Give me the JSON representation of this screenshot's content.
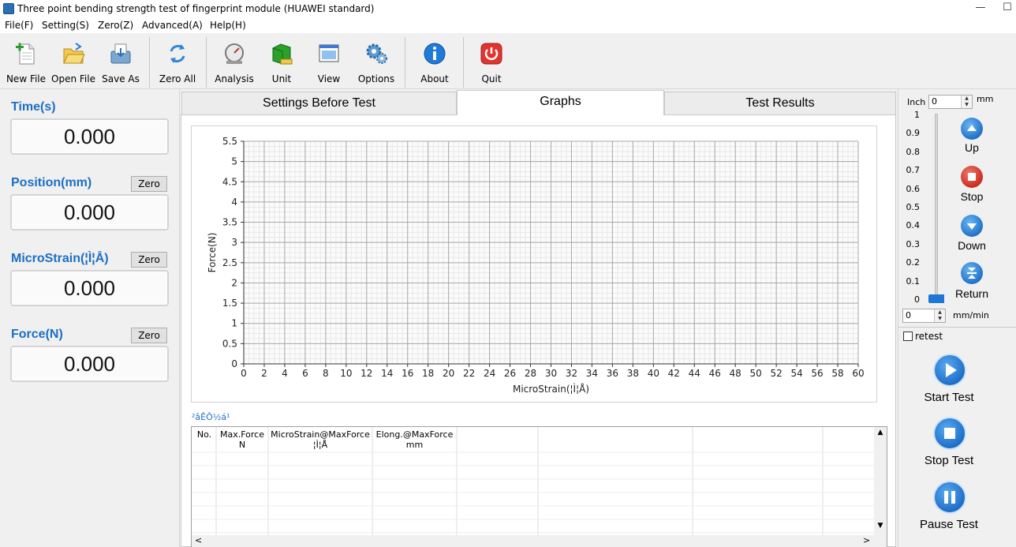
{
  "window": {
    "title": "Three point bending strength test of fingerprint module (HUAWEI standard)",
    "minimize_glyph": "—",
    "maximize_glyph": "☐"
  },
  "menu": [
    "File(F)",
    "Setting(S)",
    "Zero(Z)",
    "Advanced(A)",
    "Help(H)"
  ],
  "toolbar": {
    "new_file": "New File",
    "open_file": "Open File",
    "save_as": "Save As",
    "zero_all": "Zero All",
    "analysis": "Analysis",
    "unit": "Unit",
    "view": "View",
    "options": "Options",
    "about": "About",
    "quit": "Quit"
  },
  "measurements": {
    "time_label": "Time(s)",
    "time_value": "0.000",
    "position_label": "Position(mm)",
    "position_value": "0.000",
    "microstrain_label": "MicroStrain(¦Ì¦Å)",
    "microstrain_value": "0.000",
    "force_label": "Force(N)",
    "force_value": "0.000",
    "zero_label": "Zero"
  },
  "tabs": [
    "Settings Before Test",
    "Graphs",
    "Test Results"
  ],
  "results_table": {
    "label": "²âÊÔ½á¹",
    "headers": [
      {
        "line1": "No.",
        "line2": ""
      },
      {
        "line1": "Max.Force",
        "line2": "N"
      },
      {
        "line1": "MicroStrain@MaxForce",
        "line2": "¦Ì¦Å"
      },
      {
        "line1": "Elong.@MaxForce",
        "line2": "mm"
      }
    ],
    "scroll_up": "▲",
    "scroll_down": "▼",
    "scroll_left": "<",
    "scroll_right": ">"
  },
  "jog": {
    "inch_label": "Inch",
    "inch_value": "0",
    "inch_unit": "mm",
    "speed_value": "0",
    "speed_unit": "mm/min",
    "scale": [
      "1",
      "0.9",
      "0.8",
      "0.7",
      "0.6",
      "0.5",
      "0.4",
      "0.3",
      "0.2",
      "0.1",
      "0"
    ],
    "slider_level": 0,
    "up": "Up",
    "stop": "Stop",
    "down": "Down",
    "return": "Return",
    "retest": "retest",
    "retest_checked": false
  },
  "actions": {
    "start": "Start Test",
    "stop": "Stop Test",
    "pause": "Pause Test"
  },
  "chart_data": {
    "type": "line",
    "xlabel": "MicroStrain(¦Ì¦Å)",
    "ylabel": "Force(N)",
    "xlim": [
      0,
      60
    ],
    "ylim": [
      0,
      5.5
    ],
    "x_ticks": [
      0,
      2,
      4,
      6,
      8,
      10,
      12,
      14,
      16,
      18,
      20,
      22,
      24,
      26,
      28,
      30,
      32,
      34,
      36,
      38,
      40,
      42,
      44,
      46,
      48,
      50,
      52,
      54,
      56,
      58,
      60
    ],
    "y_ticks": [
      "0",
      "0.5",
      "1",
      "1.5",
      "2",
      "2.5",
      "3",
      "3.5",
      "4",
      "4.5",
      "5",
      "5.5"
    ],
    "grid": true,
    "series": []
  }
}
